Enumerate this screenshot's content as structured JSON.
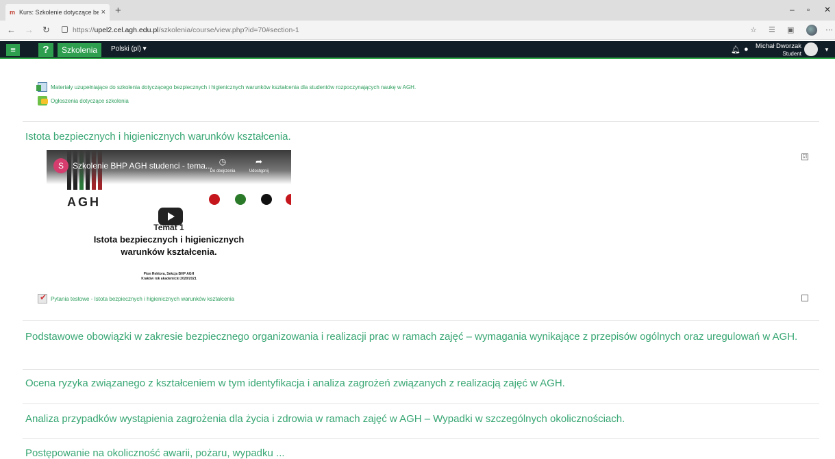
{
  "browser": {
    "tab_title": "Kurs: Szkolenie dotyczące bezpi",
    "tab_favicon": "moodle-favicon",
    "url_prefix": "https://",
    "url_host": "upel2.cel.agh.edu.pl",
    "url_path": "/szkolenia/course/view.php?id=70#section-1"
  },
  "navbar": {
    "menu_icon": "hamburger-icon",
    "help_label": "?",
    "brand_label": "Szkolenia",
    "language_label": "Polski (pl) ▾",
    "user_name": "Michał Dworzak",
    "user_role": "Student",
    "accent_color": "#2e9f4f",
    "bar_color": "#121e27"
  },
  "course": {
    "top_activities": [
      {
        "label": "Materiały uzupełniające do szkolenia dotyczącego bezpiecznych i higienicznych warunków kształcenia dla studentów rozpoczynających naukę w AGH.",
        "icon": "file-icon"
      },
      {
        "label": "Ogłoszenia dotyczące szkolenia",
        "icon": "forum-icon"
      }
    ],
    "section1": {
      "title": "Istota bezpiecznych i higienicznych warunków kształcenia.",
      "video": {
        "channel_initial": "S",
        "title": "Szkolenie BHP AGH studenci - tema...",
        "watch_later": "Do obejrzenia",
        "share": "Udostępnij",
        "logo_text": "AGH",
        "topic": "Temat 1",
        "heading_line1": "Istota bezpiecznych i higienicznych",
        "heading_line2": "warunków kształcenia.",
        "footer_line1": "Pion Rektora, Sekcja BHP AGH",
        "footer_line2": "Kraków rok akademicki 2020/2021"
      },
      "video_completion": "☑",
      "quiz_label": "Pytania testowe - Istota bezpiecznych i higienicznych warunków kształcenia",
      "quiz_completion": ""
    },
    "sections": [
      "Podstawowe obowiązki w zakresie bezpiecznego organizowania i realizacji prac w ramach zajęć – wymagania wynikające z przepisów ogólnych oraz uregulowań w AGH.",
      "Ocena ryzyka związanego z kształceniem w tym identyfikacja i analiza zagrożeń związanych z realizacją zajęć w AGH.",
      "Analiza przypadków wystąpienia zagrożenia dla życia i zdrowia w ramach zajęć w AGH – Wypadki w szczególnych okolicznościach.",
      "Postępowanie na okoliczność awarii, pożaru, wypadku ..."
    ]
  }
}
